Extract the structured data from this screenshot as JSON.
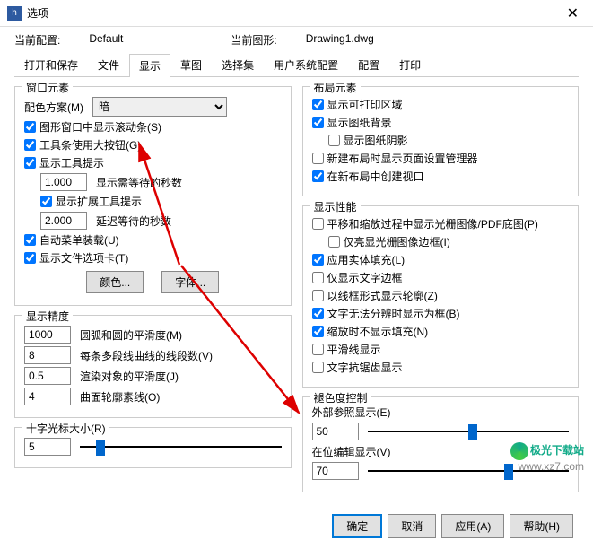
{
  "title": "选项",
  "info": {
    "cur_config_label": "当前配置:",
    "cur_config": "Default",
    "cur_drawing_label": "当前图形:",
    "cur_drawing": "Drawing1.dwg"
  },
  "tabs": [
    "打开和保存",
    "文件",
    "显示",
    "草图",
    "选择集",
    "用户系统配置",
    "配置",
    "打印"
  ],
  "left": {
    "win_elem_title": "窗口元素",
    "color_scheme_label": "配色方案(M)",
    "color_scheme_value": "暗",
    "cb_scrollbar": "图形窗口中显示滚动条(S)",
    "cb_bigbtn": "工具条使用大按钮(G)",
    "cb_tooltip": "显示工具提示",
    "tooltip_sec": "1.000",
    "tooltip_sec_label": "显示需等待的秒数",
    "cb_ext_tooltip": "显示扩展工具提示",
    "ext_sec": "2.000",
    "ext_sec_label": "延迟等待的秒数",
    "cb_autoload": "自动菜单装载(U)",
    "cb_filetab": "显示文件选项卡(T)",
    "btn_color": "颜色...",
    "btn_font": "字体...",
    "precision_title": "显示精度",
    "p1": "1000",
    "p1l": "圆弧和圆的平滑度(M)",
    "p2": "8",
    "p2l": "每条多段线曲线的线段数(V)",
    "p3": "0.5",
    "p3l": "渲染对象的平滑度(J)",
    "p4": "4",
    "p4l": "曲面轮廓素线(O)",
    "cross_title": "十字光标大小(R)",
    "cross_val": "5"
  },
  "right": {
    "layout_title": "布局元素",
    "cb_printable": "显示可打印区域",
    "cb_paperbg": "显示图纸背景",
    "cb_shadow": "显示图纸阴影",
    "cb_pgsetup": "新建布局时显示页面设置管理器",
    "cb_viewport": "在新布局中创建视口",
    "perf_title": "显示性能",
    "cb_panzoom": "平移和缩放过程中显示光栅图像/PDF底图(P)",
    "cb_highlight": "仅亮显光栅图像边框(I)",
    "cb_solidfill": "应用实体填充(L)",
    "cb_textframe": "仅显示文字边框",
    "cb_wireframe": "以线框形式显示轮廓(Z)",
    "cb_nodiff": "文字无法分辨时显示为框(B)",
    "cb_nofill": "缩放时不显示填充(N)",
    "cb_smoothline": "平滑线显示",
    "cb_antialias": "文字抗锯齿显示",
    "fade_title": "褪色度控制",
    "ext_ref_label": "外部参照显示(E)",
    "ext_ref_val": "50",
    "inplace_label": "在位编辑显示(V)",
    "inplace_val": "70"
  },
  "btns": {
    "ok": "确定",
    "cancel": "取消",
    "apply": "应用(A)",
    "help": "帮助(H)"
  },
  "wm": {
    "brand": "极光下载站",
    "url": "www.xz7.com"
  }
}
